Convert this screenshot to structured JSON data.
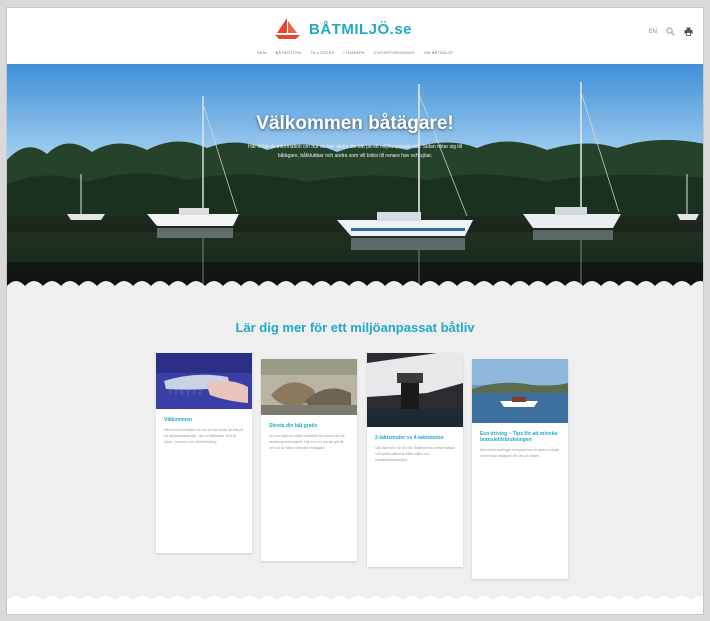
{
  "header": {
    "logo_text": "BÅTMILJÖ.se",
    "lang_label": "EN",
    "nav": [
      "Hem",
      "Båtbotten",
      "Till sjöss",
      "I hamnen",
      "Vinterförvaring",
      "Om båtmiljö"
    ]
  },
  "hero": {
    "title": "Välkommen båtägare!",
    "subtitle_line1": "Här hittar du information om hur du kan sköta din båt på ett miljöanpassat sätt. Sidan riktar sig till",
    "subtitle_line2": "båtägare, båtklubbar och andra som vill bidra till renare hav och sjöar."
  },
  "main": {
    "section_title": "Lär dig mer för ett miljöanpassat båtliv",
    "cards": [
      {
        "title": "Välkommen",
        "text": "Här finns information om hur du kan sköta din båt på ett miljöanpassat sätt. Läs om båtbotten, livet till sjöss, i hamnen och vinterförvaring."
      },
      {
        "title": "Skrota din båt gratis",
        "text": "Du som äger en uttjänt fritidsbåt kan lämna den till skrotning kostnadsfritt. Läs mer om hur det går till och var du hittar närmaste mottagare."
      },
      {
        "title": "2-taktsmotor vs 4-taktsmotor",
        "text": "Välj rätt motor för din båt. Skillnaderna mellan tvåtakt och fyrtakt påverkar både miljön och bränsleförbrukningen."
      },
      {
        "title": "Eco driving – Tips för att minska bränsleförbrukningen",
        "text": "Med enkla ändringar i körsättet kan du spara bränsle och minska utsläppen till luft och vatten."
      }
    ]
  }
}
